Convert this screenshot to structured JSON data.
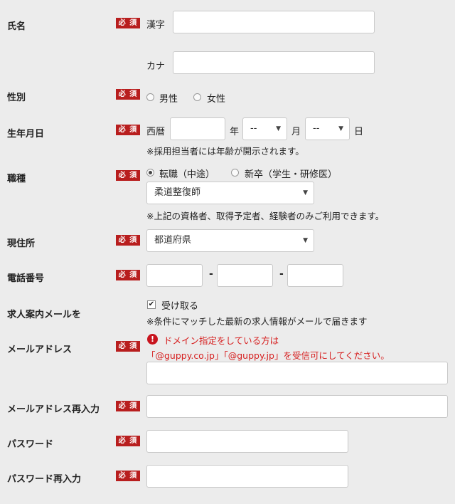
{
  "required_label": "必 須",
  "name": {
    "label": "氏名",
    "kanji_label": "漢字",
    "kana_label": "カナ",
    "kanji_value": "",
    "kana_value": ""
  },
  "gender": {
    "label": "性別",
    "options": [
      "男性",
      "女性"
    ]
  },
  "birthdate": {
    "label": "生年月日",
    "era_label": "西暦",
    "year_value": "",
    "year_unit": "年",
    "month_value": "--",
    "month_unit": "月",
    "day_value": "--",
    "day_unit": "日",
    "note": "※採用担当者には年齢が開示されます。"
  },
  "occupation": {
    "label": "職種",
    "options": [
      "転職（中途）",
      "新卒（学生・研修医）"
    ],
    "selected_option": "転職（中途）",
    "select_value": "柔道整復師",
    "note": "※上記の資格者、取得予定者、経験者のみご利用できます。"
  },
  "address": {
    "label": "現住所",
    "select_value": "都道府県"
  },
  "phone": {
    "label": "電話番号",
    "separator": "-"
  },
  "job_mail": {
    "label": "求人案内メールを",
    "checkbox_label": "受け取る",
    "checked": true,
    "note": "※条件にマッチした最新の求人情報がメールで届きます"
  },
  "email": {
    "label": "メールアドレス",
    "warning_line1": "ドメイン指定をしている方は",
    "warning_line2": "「@guppy.co.jp」「@guppy.jp」を受信可にしてください。"
  },
  "email_confirm": {
    "label": "メールアドレス再入力"
  },
  "password": {
    "label": "パスワード"
  },
  "password_confirm": {
    "label": "パスワード再入力"
  },
  "colors": {
    "required_badge": "#b81e1e",
    "warning_text": "#d61e1e",
    "background": "#ececec"
  }
}
